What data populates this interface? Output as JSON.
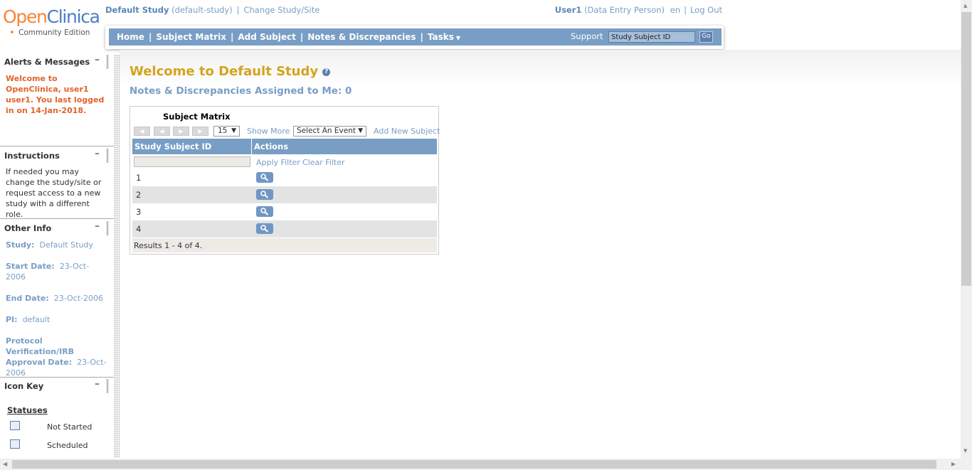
{
  "header": {
    "logo_open": "Open",
    "logo_clinica": "Clinica",
    "logo_edition": "Community Edition",
    "study_name": "Default Study",
    "study_id": "(default-study)",
    "change_study": "Change Study/Site",
    "user": "User1",
    "role": "(Data Entry Person)",
    "lang": "en",
    "logout": "Log Out"
  },
  "nav": {
    "items": [
      "Home",
      "Subject Matrix",
      "Add Subject",
      "Notes & Discrepancies",
      "Tasks"
    ],
    "support": "Support",
    "search_value": "Study Subject ID",
    "go": "Go"
  },
  "sidebar": {
    "alerts": {
      "title": "Alerts & Messages",
      "message": "Welcome to OpenClinica, user1 user1. You last logged in on 14-Jan-2018."
    },
    "instructions": {
      "title": "Instructions",
      "text": "If needed you may change the study/site or request access to a new study with a different role."
    },
    "other_info": {
      "title": "Other Info",
      "study_label": "Study:",
      "study_value": "Default Study",
      "start_label": "Start Date:",
      "start_value": "23-Oct-2006",
      "end_label": "End Date:",
      "end_value": "23-Oct-2006",
      "pi_label": "PI:",
      "pi_value": "default",
      "protocol_label": "Protocol Verification/IRB Approval Date:",
      "protocol_value": "23-Oct-2006"
    },
    "icon_key": {
      "title": "Icon Key",
      "statuses_label": "Statuses",
      "statuses": [
        "Not Started",
        "Scheduled"
      ]
    }
  },
  "main": {
    "title": "Welcome to Default Study",
    "subtitle": "Notes & Discrepancies Assigned to Me: 0",
    "matrix": {
      "title": "Subject Matrix",
      "page_size": "15",
      "show_more": "Show More",
      "event_select": "Select An Event",
      "add_new": "Add New Subject",
      "columns": [
        "Study Subject ID",
        "Actions"
      ],
      "apply_filter": "Apply Filter",
      "clear_filter": "Clear Filter",
      "rows": [
        "1",
        "2",
        "3",
        "4"
      ],
      "footer": "Results 1 - 4 of 4."
    }
  }
}
